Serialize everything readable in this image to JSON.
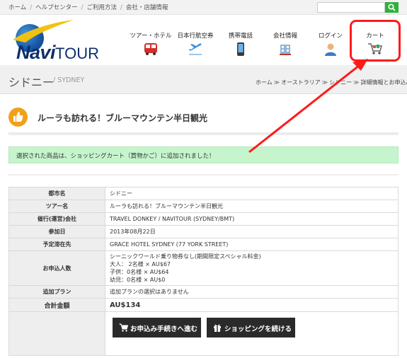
{
  "topbar": {
    "links": [
      "ホーム",
      "ヘルプセンター",
      "ご利用方法",
      "会社・店舗情報"
    ],
    "search_placeholder": ""
  },
  "logo": {
    "navi": "Navi",
    "tour": "TOUR"
  },
  "nav": {
    "items": [
      {
        "label": "ツアー・ホテル",
        "icon": "bus-icon"
      },
      {
        "label": "日本行航空券",
        "icon": "airplane-icon"
      },
      {
        "label": "携帯電話",
        "icon": "mobile-phone-icon"
      },
      {
        "label": "会社情報",
        "icon": "building-icon"
      },
      {
        "label": "ログイン",
        "icon": "user-icon"
      },
      {
        "label": "カート",
        "icon": "shopping-cart-icon"
      }
    ]
  },
  "page": {
    "title_ja": "シドニー",
    "title_en": "/ SYDNEY",
    "breadcrumb": [
      "ホーム",
      "オーストラリア",
      "シドニー",
      "詳細情報とお申込み"
    ]
  },
  "product": {
    "title": "ルーラも訪れる！ブルーマウンテン半日観光"
  },
  "notice": "選択された商品は、ショッピングカート（買物かご）に追加されました！",
  "details": {
    "rows": [
      {
        "label": "都市名",
        "value": [
          "シドニー"
        ]
      },
      {
        "label": "ツアー名",
        "value": [
          "ルーラも訪れる！ブルーマウンテン半日観光"
        ]
      },
      {
        "label": "催行(運営)会社",
        "value": [
          "TRAVEL DONKEY / NAVITOUR (SYDNEY/BMT)"
        ]
      },
      {
        "label": "参加日",
        "value": [
          "2013年08月22日"
        ]
      },
      {
        "label": "予定滞在先",
        "value": [
          "GRACE HOTEL SYDNEY (77 YORK STREET)"
        ]
      },
      {
        "label": "お申込人数",
        "value": [
          "シーニックワールド乗り物券なし(期間限定スペシャル料金)",
          "大人： 2名様 × AU$67",
          "子供：0名様 × AU$64",
          "幼児：0名様 × AU$0"
        ]
      },
      {
        "label": "追加プラン",
        "value": [
          "追加プランの選択はありません"
        ]
      }
    ],
    "total_label": "合計金額",
    "total_value": "AU$134"
  },
  "buttons": {
    "checkout": "お申込み手続きへ進む",
    "continue": "ショッピングを続ける"
  },
  "colors": {
    "search_button": "#2fb13c",
    "notice_bg": "#c6f5cd",
    "highlight": "#ff1a1a",
    "button_bg": "#2a2a2a",
    "product_icon": "#f0a11a"
  }
}
